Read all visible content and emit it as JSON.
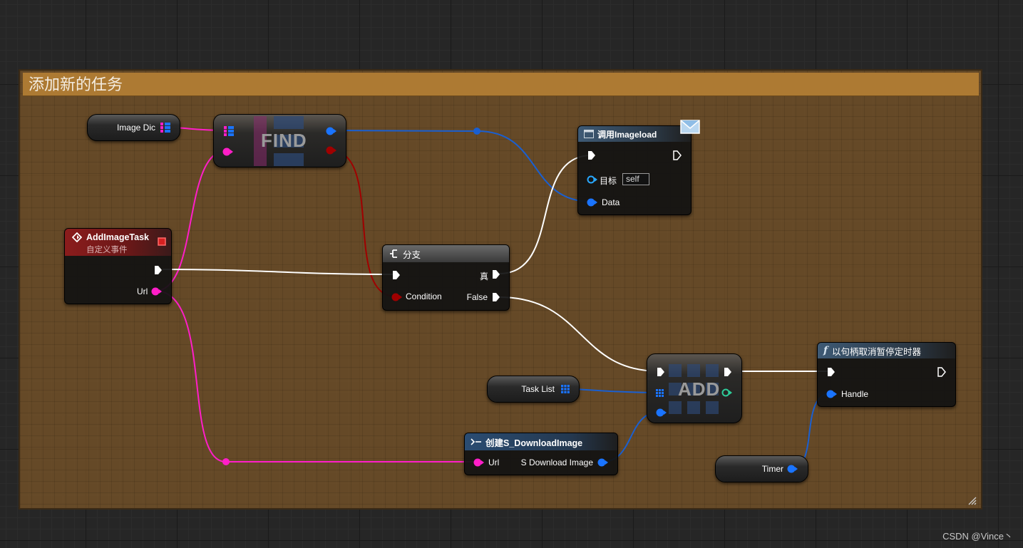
{
  "comment": {
    "title": "添加新的任务"
  },
  "nodes": {
    "image_dic": {
      "label": "Image Dic"
    },
    "find": {
      "label": "FIND"
    },
    "call_imageload": {
      "title": "调用Imageload",
      "target_label": "目标",
      "target_value": "self",
      "data_label": "Data"
    },
    "add_image_task": {
      "title": "AddImageTask",
      "subtitle": "自定义事件",
      "url_label": "Url"
    },
    "branch": {
      "title": "分支",
      "condition_label": "Condition",
      "true_label": "真",
      "false_label": "False"
    },
    "task_list": {
      "label": "Task List"
    },
    "add": {
      "label": "ADD"
    },
    "pause_timer": {
      "title": "以句柄取消暂停定时器",
      "handle_label": "Handle"
    },
    "create_widget": {
      "title": "创建S_DownloadImage",
      "url_label": "Url",
      "output_label": "S Download Image"
    },
    "timer": {
      "label": "Timer"
    }
  },
  "colors": {
    "exec": "#ffffff",
    "string_pin": "#ff1ec8",
    "object_pin": "#1a74ff",
    "bool_pin": "#b00000",
    "int_pin": "#2ecc9a",
    "comment_title": "#ad7a33",
    "event_header": "#8b1c1c"
  },
  "watermark": "CSDN @Vince丶"
}
